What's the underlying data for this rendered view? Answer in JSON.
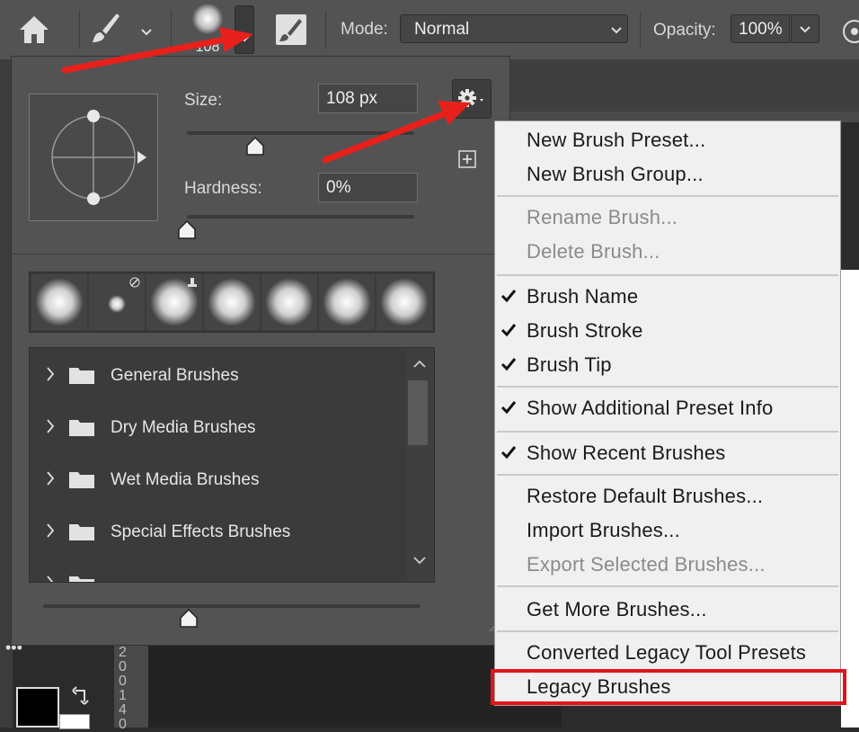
{
  "options_bar": {
    "brush_preview_size": "108",
    "mode_label": "Mode:",
    "mode_value": "Normal",
    "opacity_label": "Opacity:",
    "opacity_value": "100%"
  },
  "brush_picker": {
    "size_label": "Size:",
    "size_value": "108 px",
    "size_fraction": 0.3,
    "hardness_label": "Hardness:",
    "hardness_value": "0%",
    "hardness_fraction": 0,
    "groups": [
      "General Brushes",
      "Dry Media Brushes",
      "Wet Media Brushes",
      "Special Effects Brushes"
    ]
  },
  "flyout_menu": {
    "items": [
      {
        "label": "New Brush Preset...",
        "enabled": true,
        "checked": false
      },
      {
        "label": "New Brush Group...",
        "enabled": true,
        "checked": false
      },
      {
        "label": "Rename Brush...",
        "enabled": false,
        "checked": false
      },
      {
        "label": "Delete Brush...",
        "enabled": false,
        "checked": false
      },
      {
        "label": "Brush Name",
        "enabled": true,
        "checked": true
      },
      {
        "label": "Brush Stroke",
        "enabled": true,
        "checked": true
      },
      {
        "label": "Brush Tip",
        "enabled": true,
        "checked": true
      },
      {
        "label": "Show Additional Preset Info",
        "enabled": true,
        "checked": true
      },
      {
        "label": "Show Recent Brushes",
        "enabled": true,
        "checked": true
      },
      {
        "label": "Restore Default Brushes...",
        "enabled": true,
        "checked": false
      },
      {
        "label": "Import Brushes...",
        "enabled": true,
        "checked": false
      },
      {
        "label": "Export Selected Brushes...",
        "enabled": false,
        "checked": false
      },
      {
        "label": "Get More Brushes...",
        "enabled": true,
        "checked": false
      },
      {
        "label": "Converted Legacy Tool Presets",
        "enabled": true,
        "checked": false
      },
      {
        "label": "Legacy Brushes",
        "enabled": true,
        "checked": false
      }
    ],
    "highlighted_item": "Legacy Brushes"
  },
  "ruler": {
    "left_digits": "200140"
  },
  "colors": {
    "panel": "#535353",
    "menu_bg": "#f0f0f0",
    "annotation_red": "#e3131b",
    "arrow_red": "#e8201c"
  }
}
